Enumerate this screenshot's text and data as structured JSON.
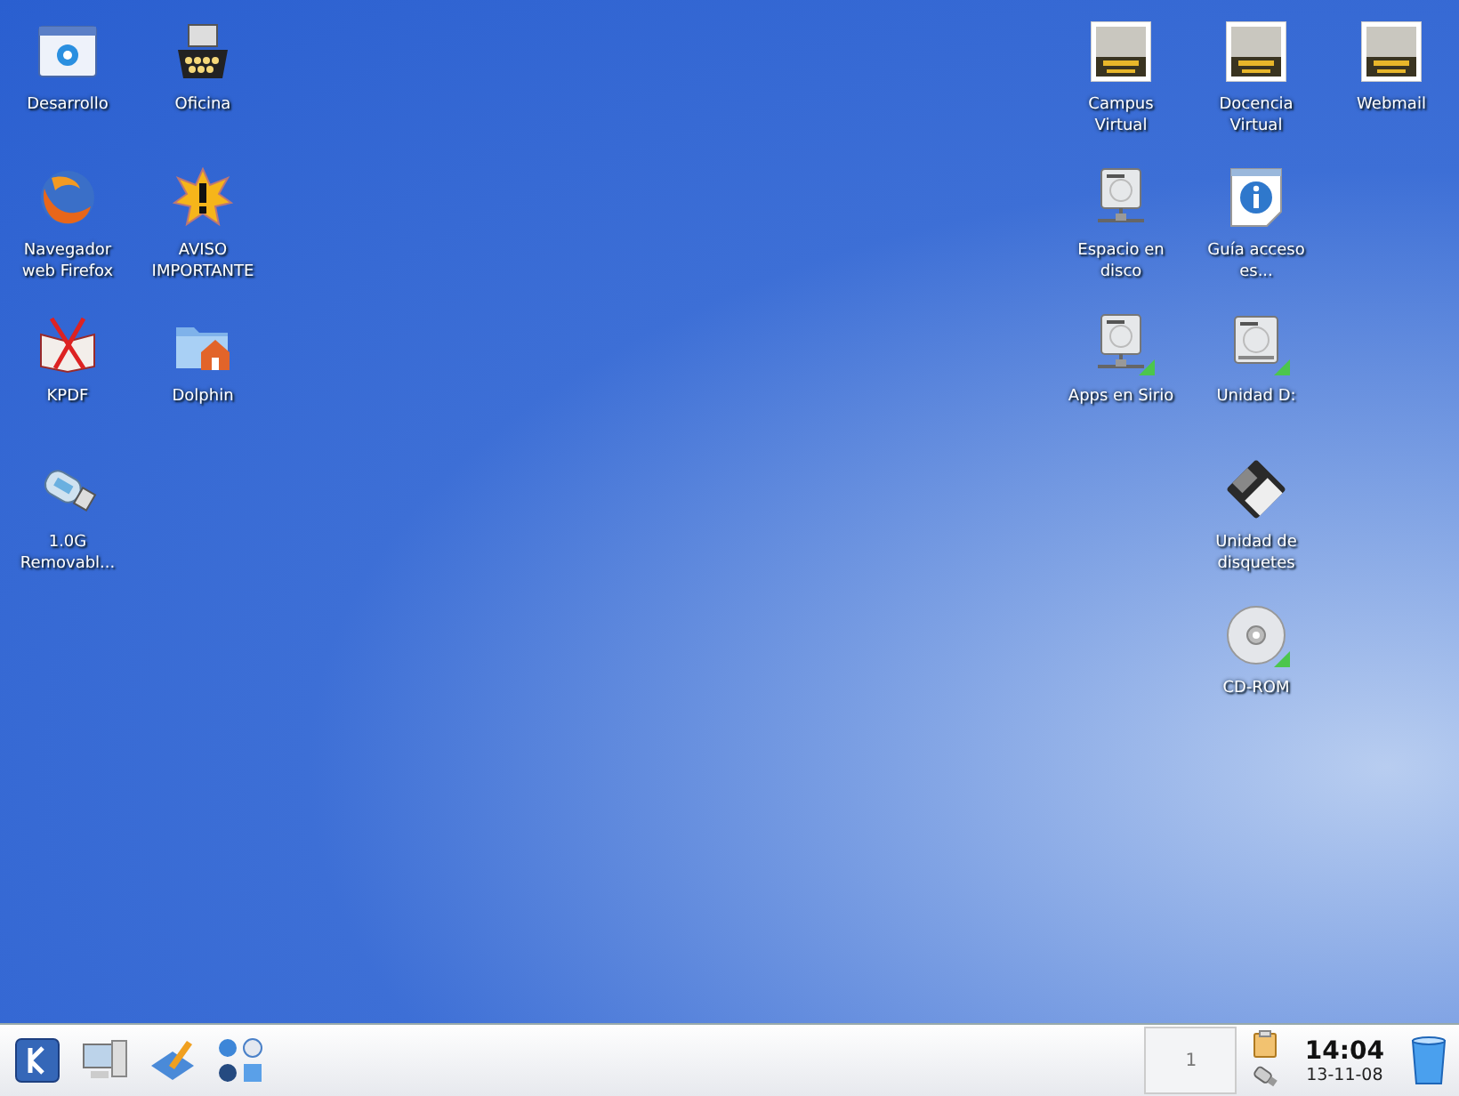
{
  "desktop": {
    "left_columns": [
      [
        {
          "kind": "folder-app",
          "label": "Desarrollo",
          "mounted": false
        },
        {
          "kind": "browser",
          "label": "Navegador web Firefox",
          "mounted": false
        },
        {
          "kind": "pdf",
          "label": "KPDF",
          "mounted": false
        },
        {
          "kind": "usb",
          "label": "1.0G Removabl...",
          "mounted": false
        }
      ],
      [
        {
          "kind": "office",
          "label": "Oficina",
          "mounted": false
        },
        {
          "kind": "warning",
          "label": "AVISO IMPORTANTE",
          "mounted": false
        },
        {
          "kind": "home-folder",
          "label": "Dolphin",
          "mounted": false
        }
      ]
    ],
    "right_columns": [
      [
        {
          "kind": "web-thumb",
          "label": "Campus Virtual",
          "mounted": false
        },
        {
          "kind": "network-drive",
          "label": "Espacio en disco",
          "mounted": false
        },
        {
          "kind": "network-drive",
          "label": "Apps en Sirio",
          "mounted": true
        }
      ],
      [
        {
          "kind": "web-thumb",
          "label": "Docencia Virtual",
          "mounted": false
        },
        {
          "kind": "info-doc",
          "label": "Guía acceso es...",
          "mounted": false
        },
        {
          "kind": "drive",
          "label": "Unidad D:",
          "mounted": true
        },
        {
          "kind": "floppy",
          "label": "Unidad de disquetes",
          "mounted": false
        },
        {
          "kind": "cdrom",
          "label": "CD-ROM",
          "mounted": true
        }
      ],
      [
        {
          "kind": "web-thumb",
          "label": "Webmail",
          "mounted": false
        }
      ]
    ]
  },
  "taskbar": {
    "launchers": [
      {
        "kind": "kmenu"
      },
      {
        "kind": "computer"
      },
      {
        "kind": "editor"
      },
      {
        "kind": "quad"
      }
    ],
    "pager": [
      {
        "label": "1",
        "selected": true
      }
    ],
    "clock": {
      "time": "14:04",
      "date": "13-11-08"
    }
  }
}
